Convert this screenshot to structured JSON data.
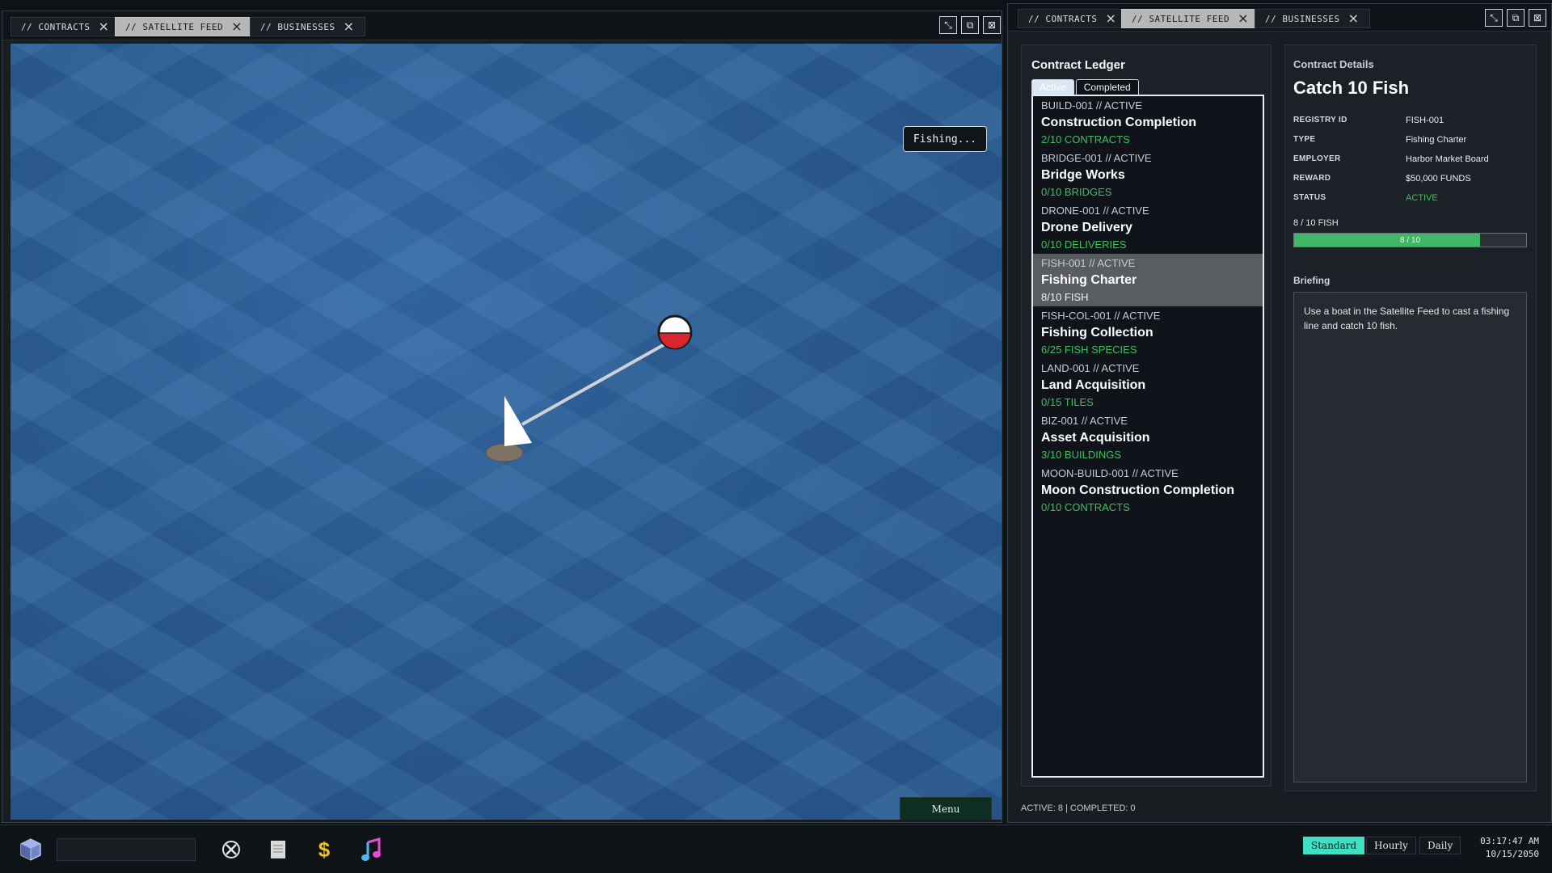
{
  "left_window": {
    "tabs": [
      {
        "label": "// CONTRACTS"
      },
      {
        "label": "// SATELLITE FEED",
        "active": true
      },
      {
        "label": "// BUSINESSES"
      }
    ],
    "status_text": "Fishing...",
    "menu_label": "Menu"
  },
  "right_window": {
    "tabs": [
      {
        "label": "// CONTRACTS"
      },
      {
        "label": "// SATELLITE FEED",
        "active": true
      },
      {
        "label": "// BUSINESSES"
      }
    ],
    "ledger": {
      "title": "Contract Ledger",
      "tab_active": "Active",
      "tab_completed": "Completed",
      "items": [
        {
          "meta": "BUILD-001 // ACTIVE",
          "name": "Construction Completion",
          "progress": "2/10 CONTRACTS"
        },
        {
          "meta": "BRIDGE-001 // ACTIVE",
          "name": "Bridge Works",
          "progress": "0/10 BRIDGES"
        },
        {
          "meta": "DRONE-001 // ACTIVE",
          "name": "Drone Delivery",
          "progress": "0/10 DELIVERIES"
        },
        {
          "meta": "FISH-001 // ACTIVE",
          "name": "Fishing Charter",
          "progress": "8/10 FISH",
          "selected": true
        },
        {
          "meta": "FISH-COL-001 // ACTIVE",
          "name": "Fishing Collection",
          "progress": "6/25 FISH SPECIES"
        },
        {
          "meta": "LAND-001 // ACTIVE",
          "name": "Land Acquisition",
          "progress": "0/15 TILES"
        },
        {
          "meta": "BIZ-001 // ACTIVE",
          "name": "Asset Acquisition",
          "progress": "3/10 BUILDINGS"
        },
        {
          "meta": "MOON-BUILD-001 // ACTIVE",
          "name": "Moon Construction Completion",
          "progress": "0/10 CONTRACTS"
        }
      ],
      "footer": "ACTIVE: 8 | COMPLETED: 0"
    },
    "details": {
      "section_label": "Contract Details",
      "title": "Catch 10 Fish",
      "fields": {
        "registry_id_label": "REGISTRY ID",
        "registry_id": "FISH-001",
        "type_label": "TYPE",
        "type": "Fishing Charter",
        "employer_label": "EMPLOYER",
        "employer": "Harbor Market Board",
        "reward_label": "REWARD",
        "reward": "$50,000 FUNDS",
        "status_label": "STATUS",
        "status": "ACTIVE"
      },
      "progress_label": "8 / 10 FISH",
      "progress_bar_text": "8 / 10",
      "progress_fraction": 0.8,
      "briefing_label": "Briefing",
      "briefing_text": "Use a boat in the Satellite Feed to cast a fishing line and catch 10 fish."
    }
  },
  "taskbar": {
    "icons": [
      "cube-app-icon",
      "tools-icon",
      "ledger-icon",
      "dollar-icon",
      "music-icon"
    ],
    "speeds": [
      {
        "label": "Standard",
        "active": true
      },
      {
        "label": "Hourly"
      },
      {
        "label": "Daily"
      }
    ],
    "time": "03:17:47 AM",
    "date": "10/15/2050"
  },
  "colors": {
    "water": "#2f659f",
    "progress_green": "#3fbf5f",
    "speed_active": "#3ee0c4"
  }
}
